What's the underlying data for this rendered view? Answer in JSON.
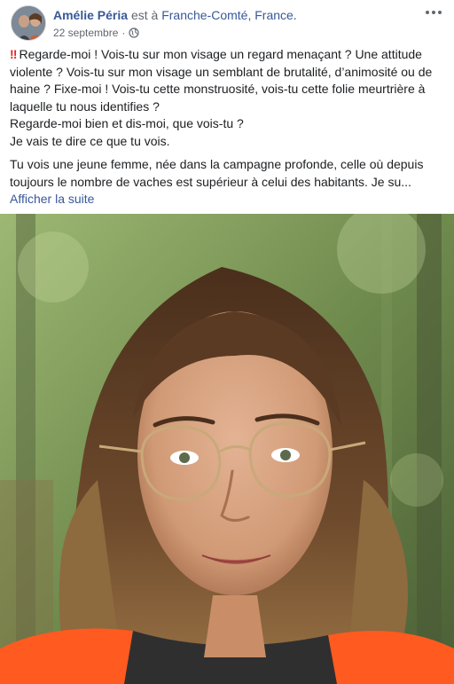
{
  "post": {
    "author": {
      "name": "Amélie Péria",
      "connector": "est à",
      "location": "Franche-Comté, France."
    },
    "meta": {
      "date": "22 septembre",
      "separator": "·",
      "privacy_icon": "globe-icon"
    },
    "more_icon": "more-options-icon",
    "body": {
      "first_paragraph": {
        "prefix_icon": "double-exclamation-icon",
        "lines": [
          "Regarde-moi ! Vois-tu sur mon visage un regard menaçant ? Une attitude violente ? Vois-tu sur mon visage un semblant de brutalité, d’animosité ou de haine ? Fixe-moi ! Vois-tu cette monstruosité, vois-tu cette folie meurtrière à laquelle tu nous identifies ?",
          "Regarde-moi bien et dis-moi, que vois-tu ?",
          "Je vais te dire ce que tu vois."
        ]
      },
      "second_paragraph": "Tu vois une jeune femme, née dans la campagne profonde, celle où depuis toujours le nombre de vaches est supérieur à celui des habitants. Je su...",
      "see_more_label": "Afficher la suite"
    },
    "photo": {
      "subject": "selfie-photo",
      "colors": {
        "forest_light": "#b7c98a",
        "forest_dark": "#4f6a3a",
        "hair": "#6b4a2c",
        "skin": "#d6a27e",
        "jacket": "#ff5a1f"
      }
    }
  }
}
